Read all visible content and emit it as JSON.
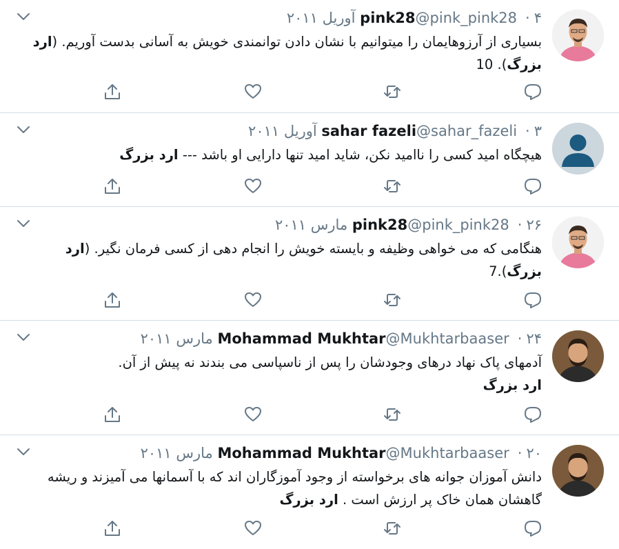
{
  "colors": {
    "background": "#e6ecf0",
    "card": "#ffffff",
    "muted": "#657786",
    "icon": "#657786"
  },
  "tweets": [
    {
      "name": "pink28",
      "handle": "@pink_pink28",
      "date": "۴ آوریل ۲۰۱۱",
      "text_pre": "بسیاری از آرزوهایمان را میتوانیم با نشان دادن توانمندی خویش به آسانی بدست آوریم. (",
      "text_bold": "ارد بزرگ",
      "text_post": "). 10",
      "avatar": "man-pink-shirt-avatar"
    },
    {
      "name": "sahar fazeli",
      "handle": "@sahar_fazeli",
      "date": "۳ آوریل ۲۰۱۱",
      "text_pre": "هیچگاه امید کسی را ناامید نکن، شاید امید تنها دارایی او باشد --- ",
      "text_bold": "ارد بزرگ",
      "text_post": "",
      "avatar": "default-avatar"
    },
    {
      "name": "pink28",
      "handle": "@pink_pink28",
      "date": "۲۶ مارس ۲۰۱۱",
      "text_pre": "هنگامی که می خواهی وظیفه و بایسته خویش را انجام دهی از کسی فرمان نگیر. (",
      "text_bold": "ارد بزرگ",
      "text_post": ").7",
      "avatar": "man-pink-shirt-avatar"
    },
    {
      "name": "Mohammad Mukhtar",
      "handle": "@Mukhtarbaaser",
      "date": "۲۴ مارس ۲۰۱۱",
      "text_pre": "آدمهای پاک نهاد درهای وجودشان را پس از ناسپاسی می بندند نه پیش از آن.",
      "text_bold": "ارد بزرگ",
      "text_post": "",
      "avatar": "man-beard-avatar"
    },
    {
      "name": "Mohammad Mukhtar",
      "handle": "@Mukhtarbaaser",
      "date": "۲۰ مارس ۲۰۱۱",
      "text_pre": "دانش آموزان جوانه های برخواسته از وجود آموزگاران اند که با آسمانها می آمیزند و ریشه گاهشان همان خاک پر ارزش است . ",
      "text_bold": "ارد بزرگ",
      "text_post": "",
      "avatar": "man-beard-avatar"
    }
  ]
}
